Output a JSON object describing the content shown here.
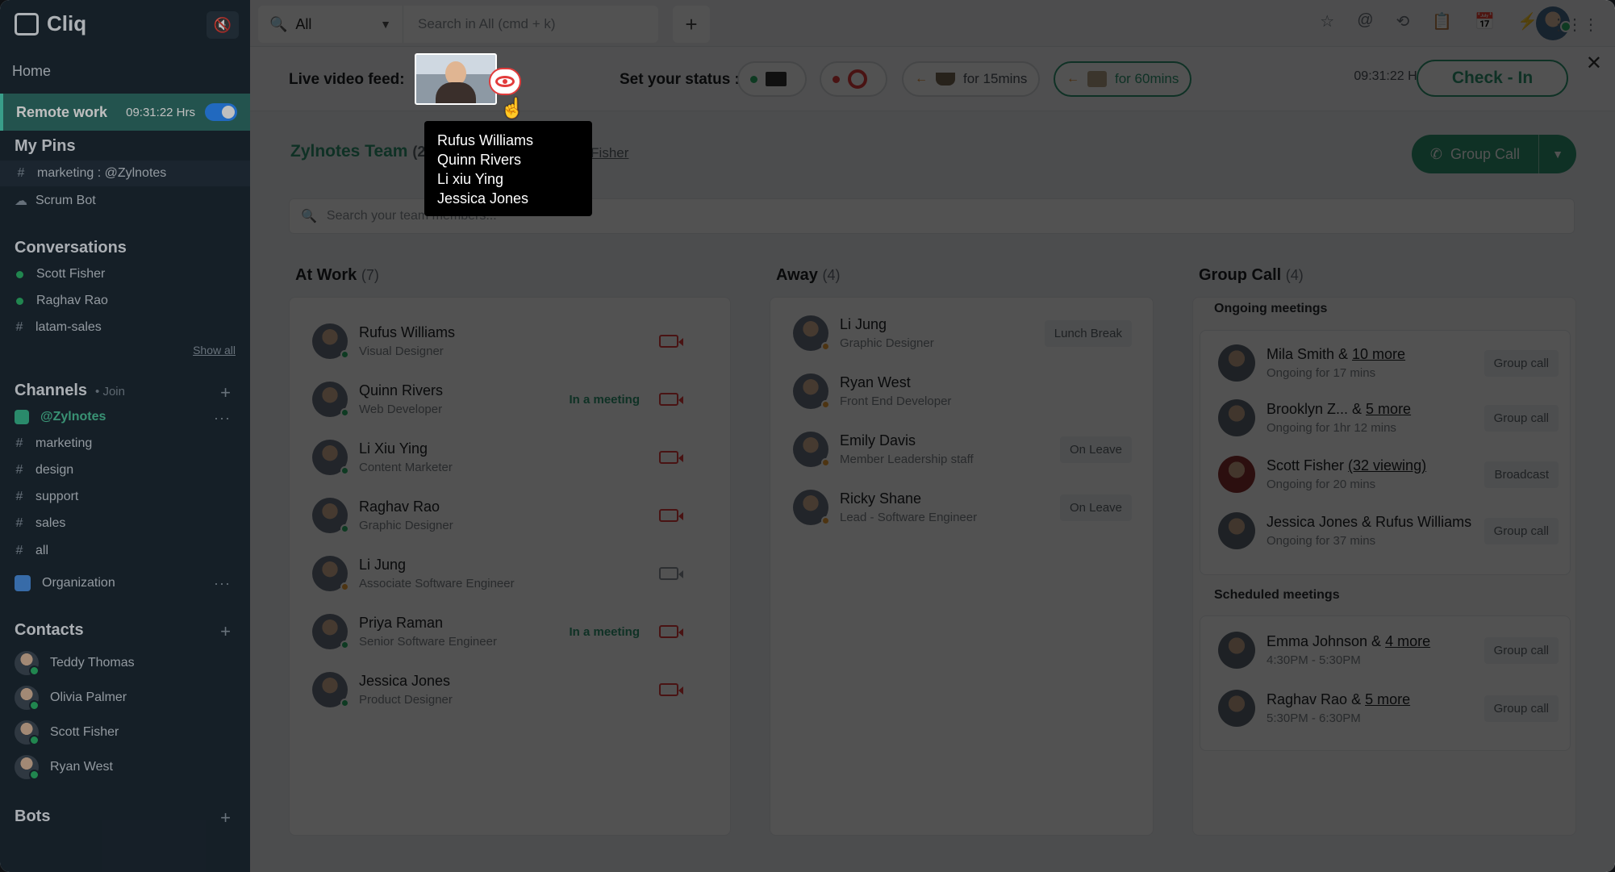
{
  "app": {
    "name": "Cliq"
  },
  "sidebar": {
    "home": "Home",
    "remote": {
      "label": "Remote work",
      "time": "09:31:22 Hrs"
    },
    "pins_title": "My Pins",
    "pins": [
      {
        "label": "marketing : @Zylnotes"
      },
      {
        "label": "Scrum Bot"
      }
    ],
    "conversations_title": "Conversations",
    "conversations": [
      {
        "label": "Scott Fisher"
      },
      {
        "label": "Raghav Rao"
      },
      {
        "label": "latam-sales"
      }
    ],
    "show_all": "Show all",
    "channels_title": "Channels",
    "channels_join": "• Join",
    "channels": [
      {
        "label": "@Zylnotes"
      },
      {
        "label": "marketing"
      },
      {
        "label": "design"
      },
      {
        "label": "support"
      },
      {
        "label": "sales"
      },
      {
        "label": "all"
      }
    ],
    "organization": "Organization",
    "contacts_title": "Contacts",
    "contacts": [
      {
        "label": "Teddy Thomas"
      },
      {
        "label": "Olivia Palmer"
      },
      {
        "label": "Scott Fisher"
      },
      {
        "label": "Ryan West"
      }
    ],
    "bots_title": "Bots"
  },
  "topbar": {
    "scope": "All",
    "search_placeholder": "Search in All (cmd + k)"
  },
  "statusbar": {
    "live_label": "Live video feed:",
    "status_label": "Set your status :",
    "options": [
      {
        "text": ""
      },
      {
        "text": ""
      },
      {
        "text": "for 15mins"
      },
      {
        "text": "for 60mins"
      }
    ],
    "time": "09:31:22 Hrs",
    "checkin": "Check - In"
  },
  "tooltip": {
    "names": [
      "Rufus Williams",
      "Quinn Rivers",
      "Li xiu Ying",
      "Jessica Jones"
    ]
  },
  "team": {
    "title": "Zylnotes Team",
    "count": "(24",
    "sub": "tt Fisher",
    "search_placeholder": "Search your team members...",
    "group_call": "Group Call"
  },
  "columns": {
    "at_work": {
      "title": "At Work",
      "count": "(7)"
    },
    "away": {
      "title": "Away",
      "count": "(4)"
    },
    "group_call": {
      "title": "Group Call",
      "count": "(4)"
    }
  },
  "at_work": [
    {
      "name": "Rufus Williams",
      "role": "Visual Designer",
      "meeting": ""
    },
    {
      "name": "Quinn Rivers",
      "role": "Web Developer",
      "meeting": "In a meeting"
    },
    {
      "name": "Li Xiu Ying",
      "role": "Content Marketer",
      "meeting": ""
    },
    {
      "name": "Raghav Rao",
      "role": "Graphic Designer",
      "meeting": ""
    },
    {
      "name": "Li Jung",
      "role": "Associate Software Engineer",
      "meeting": ""
    },
    {
      "name": "Priya Raman",
      "role": "Senior Software Engineer",
      "meeting": "In a meeting"
    },
    {
      "name": "Jessica Jones",
      "role": "Product Designer",
      "meeting": ""
    }
  ],
  "away": [
    {
      "name": "Li Jung",
      "role": "Graphic Designer",
      "tag": "Lunch Break"
    },
    {
      "name": "Ryan West",
      "role": "Front End Developer",
      "tag": ""
    },
    {
      "name": "Emily Davis",
      "role": "Member Leadership staff",
      "tag": "On Leave"
    },
    {
      "name": "Ricky Shane",
      "role": "Lead - Software Engineer",
      "tag": "On Leave"
    }
  ],
  "group_calls": {
    "ongoing_title": "Ongoing meetings",
    "ongoing": [
      {
        "name": "Mila Smith & ",
        "more": "10 more",
        "time": "Ongoing for 17 mins",
        "tag": "Group call"
      },
      {
        "name": "Brooklyn Z... & ",
        "more": "5 more",
        "time": "Ongoing for 1hr 12 mins",
        "tag": "Group call"
      },
      {
        "name": "Scott Fisher ",
        "more": "(32 viewing)",
        "time": "Ongoing for 20 mins",
        "tag": "Broadcast"
      },
      {
        "name": "Jessica Jones & Rufus Williams",
        "more": "",
        "time": "Ongoing for 37 mins",
        "tag": "Group call"
      }
    ],
    "scheduled_title": "Scheduled meetings",
    "scheduled": [
      {
        "name": "Emma Johnson & ",
        "more": "4 more",
        "time": "4:30PM - 5:30PM",
        "tag": "Group call"
      },
      {
        "name": "Raghav Rao & ",
        "more": "5 more",
        "time": "5:30PM - 6:30PM",
        "tag": "Group call"
      }
    ]
  }
}
